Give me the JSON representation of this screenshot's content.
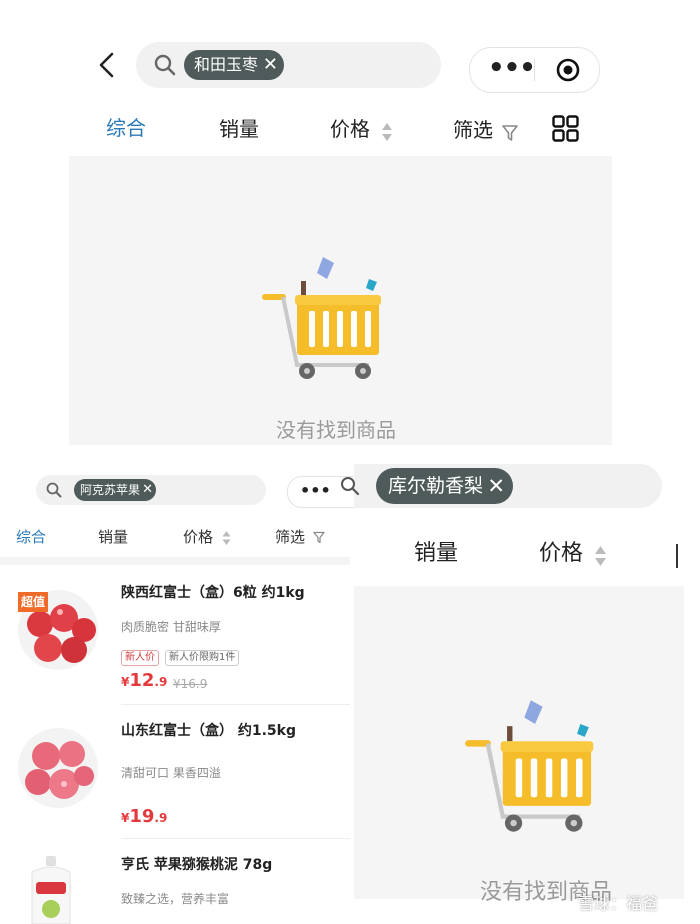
{
  "top": {
    "search_chip": "和田玉枣",
    "chip_close": "✕",
    "tabs": [
      "综合",
      "销量",
      "价格",
      "筛选"
    ],
    "empty_text": "没有找到商品"
  },
  "left": {
    "search_chip": "阿克苏苹果",
    "chip_close": "✕",
    "tabs": [
      "综合",
      "销量",
      "价格",
      "筛选"
    ],
    "products": [
      {
        "badge": "超值",
        "name": "陕西红富士（盒）6粒 约1kg",
        "desc": "肉质脆密 甘甜味厚",
        "tags": [
          "新人价",
          "新人价限购1件"
        ],
        "currency": "¥",
        "price_int": "12",
        "price_dec": ".9",
        "old_price": "¥16.9"
      },
      {
        "name": "山东红富士（盒） 约1.5kg",
        "desc": "清甜可口 果香四溢",
        "currency": "¥",
        "price_int": "19",
        "price_dec": ".9"
      },
      {
        "name": "亨氏 苹果猕猴桃泥 78g",
        "desc": "致臻之选，营养丰富"
      }
    ]
  },
  "right": {
    "search_chip": "库尔勒香梨",
    "chip_close": "✕",
    "tabs": [
      "销量",
      "价格"
    ],
    "empty_text": "没有找到商品"
  },
  "watermark": "雪球：福爸",
  "colors": {
    "accent": "#2b7ab8",
    "chip_bg": "#4f5a5a",
    "price_red": "#e4393c",
    "cart_yellow": "#f6bd2b",
    "empty_bg": "#f5f5f5"
  }
}
